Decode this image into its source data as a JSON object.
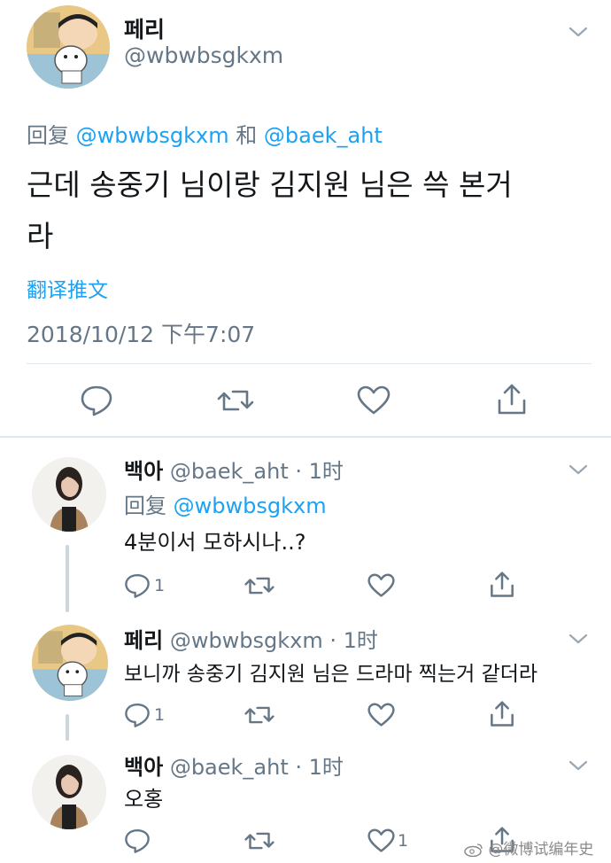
{
  "main_tweet": {
    "display_name": "페리",
    "handle": "@wbwbsgkxm",
    "reply_prefix": "回复",
    "reply_to_1": "@wbwbsgkxm",
    "reply_and": "和",
    "reply_to_2": "@baek_aht",
    "text_line1": "근데 송중기 님이랑 김지원 님은 쓱 본거",
    "text_line2": "라",
    "translate_label": "翻译推文",
    "timestamp": "2018/10/12 下午7:07"
  },
  "replies": [
    {
      "display_name": "백아",
      "meta": "@baek_aht · 1时",
      "reply_prefix": "回复",
      "reply_to": "@wbwbsgkxm",
      "text": "4분이서 모하시나..?",
      "reply_count": "1",
      "like_count": ""
    },
    {
      "display_name": "페리",
      "meta": "@wbwbsgkxm · 1时",
      "text": "보니까 송중기 김지원 님은 드라마 찍는거 같더라",
      "reply_count": "1",
      "like_count": ""
    },
    {
      "display_name": "백아",
      "meta": "@baek_aht · 1时",
      "text": "오홍",
      "reply_count": "",
      "like_count": "1"
    }
  ],
  "watermark": "@微博试编年史",
  "colors": {
    "link": "#1da1f2",
    "secondary": "#657786",
    "divider": "#e1e8ed"
  },
  "icons": [
    "reply-icon",
    "retweet-icon",
    "like-icon",
    "share-icon",
    "chevron-down-icon"
  ]
}
